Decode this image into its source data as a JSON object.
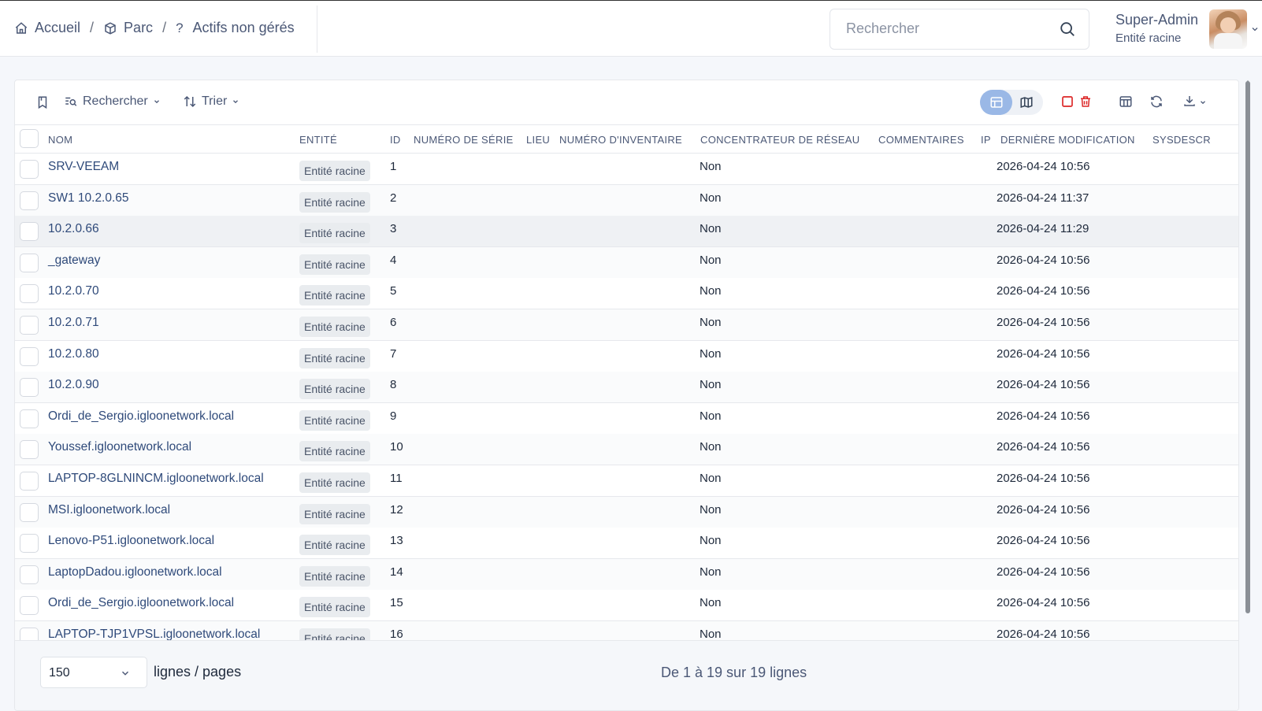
{
  "breadcrumb": {
    "home": "Accueil",
    "sep1": "/",
    "parc": "Parc",
    "sep2": "/",
    "current": "Actifs non gérés",
    "current_icon": "?"
  },
  "header_search": {
    "placeholder": "Rechercher"
  },
  "user": {
    "name": "Super-Admin",
    "entity": "Entité racine"
  },
  "toolbar": {
    "search_label": "Rechercher",
    "sort_label": "Trier"
  },
  "table": {
    "columns": [
      "NOM",
      "ENTITÉ",
      "ID",
      "NUMÉRO DE SÉRIE",
      "LIEU",
      "NUMÉRO D'INVENTAIRE",
      "CONCENTRATEUR DE RÉSEAU",
      "COMMENTAIRES",
      "IP",
      "DERNIÈRE MODIFICATION",
      "SYSDESCR"
    ],
    "rows": [
      {
        "name": "SRV-VEEAM",
        "entity": "Entité racine",
        "id": "1",
        "hub": "Non",
        "modified": "2026-04-24 10:56"
      },
      {
        "name": "SW1 10.2.0.65",
        "entity": "Entité racine",
        "id": "2",
        "hub": "Non",
        "modified": "2026-04-24 11:37"
      },
      {
        "name": "10.2.0.66",
        "entity": "Entité racine",
        "id": "3",
        "hub": "Non",
        "modified": "2026-04-24 11:29"
      },
      {
        "name": "_gateway",
        "entity": "Entité racine",
        "id": "4",
        "hub": "Non",
        "modified": "2026-04-24 10:56"
      },
      {
        "name": "10.2.0.70",
        "entity": "Entité racine",
        "id": "5",
        "hub": "Non",
        "modified": "2026-04-24 10:56"
      },
      {
        "name": "10.2.0.71",
        "entity": "Entité racine",
        "id": "6",
        "hub": "Non",
        "modified": "2026-04-24 10:56"
      },
      {
        "name": "10.2.0.80",
        "entity": "Entité racine",
        "id": "7",
        "hub": "Non",
        "modified": "2026-04-24 10:56"
      },
      {
        "name": "10.2.0.90",
        "entity": "Entité racine",
        "id": "8",
        "hub": "Non",
        "modified": "2026-04-24 10:56"
      },
      {
        "name": "Ordi_de_Sergio.igloonetwork.local",
        "entity": "Entité racine",
        "id": "9",
        "hub": "Non",
        "modified": "2026-04-24 10:56"
      },
      {
        "name": "Youssef.igloonetwork.local",
        "entity": "Entité racine",
        "id": "10",
        "hub": "Non",
        "modified": "2026-04-24 10:56"
      },
      {
        "name": "LAPTOP-8GLNINCM.igloonetwork.local",
        "entity": "Entité racine",
        "id": "11",
        "hub": "Non",
        "modified": "2026-04-24 10:56"
      },
      {
        "name": "MSI.igloonetwork.local",
        "entity": "Entité racine",
        "id": "12",
        "hub": "Non",
        "modified": "2026-04-24 10:56"
      },
      {
        "name": "Lenovo-P51.igloonetwork.local",
        "entity": "Entité racine",
        "id": "13",
        "hub": "Non",
        "modified": "2026-04-24 10:56"
      },
      {
        "name": "LaptopDadou.igloonetwork.local",
        "entity": "Entité racine",
        "id": "14",
        "hub": "Non",
        "modified": "2026-04-24 10:56"
      },
      {
        "name": "Ordi_de_Sergio.igloonetwork.local",
        "entity": "Entité racine",
        "id": "15",
        "hub": "Non",
        "modified": "2026-04-24 10:56"
      },
      {
        "name": "LAPTOP-TJP1VPSL.igloonetwork.local",
        "entity": "Entité racine",
        "id": "16",
        "hub": "Non",
        "modified": "2026-04-24 10:56"
      }
    ]
  },
  "footer": {
    "per_page_value": "150",
    "per_page_label": "lignes / pages",
    "pagination_text": "De 1 à 19 sur 19 lignes"
  },
  "colors": {
    "accent": "#9ab8e6",
    "link": "#2f4a7a",
    "danger": "#dc2626",
    "text_muted": "#4b5876"
  }
}
